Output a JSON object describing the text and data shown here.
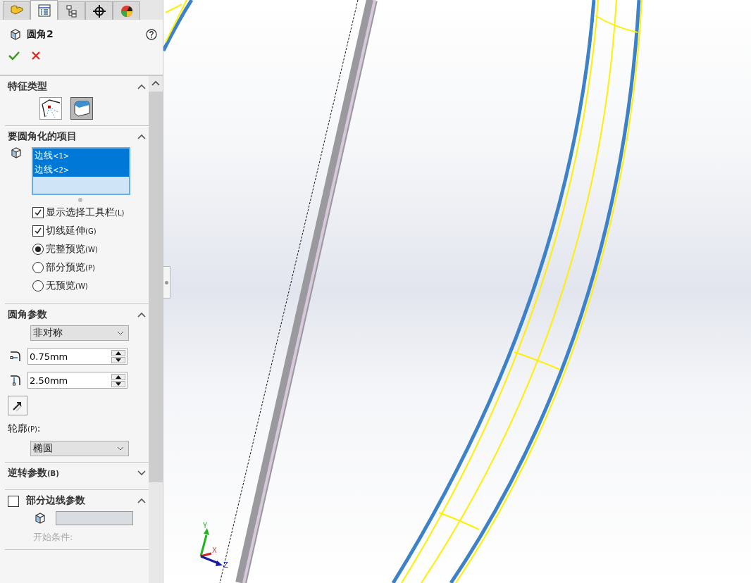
{
  "tabs": [
    {
      "kind": "part",
      "selected": false
    },
    {
      "kind": "properties",
      "selected": true
    },
    {
      "kind": "configuration",
      "selected": false
    },
    {
      "kind": "crosshair",
      "selected": false
    },
    {
      "kind": "appearance",
      "selected": false
    }
  ],
  "feature": {
    "title": "圆角2"
  },
  "sections": [
    {
      "kind": "feature_type",
      "title": "特征类型",
      "expanded": true,
      "options": [
        {
          "kind": "constant",
          "selected": false
        },
        {
          "kind": "variable",
          "selected": true
        }
      ]
    },
    {
      "kind": "items",
      "title": "要圆角化的项目",
      "expanded": true,
      "edges": [
        {
          "name": "边线",
          "index": "<1>",
          "selected": true
        },
        {
          "name": "边线",
          "index": "<2>",
          "selected": true
        }
      ],
      "checkboxes": [
        {
          "label": "显示选择工具栏",
          "shortcut": "(L)",
          "checked": true
        },
        {
          "label": "切线延伸",
          "shortcut": "(G)",
          "checked": true
        }
      ],
      "radios": [
        {
          "label": "完整预览",
          "shortcut": "(W)",
          "selected": true
        },
        {
          "label": "部分预览",
          "shortcut": "(P)",
          "selected": false
        },
        {
          "label": "无预览",
          "shortcut": "(W)",
          "selected": false
        }
      ]
    },
    {
      "kind": "params",
      "title": "圆角参数",
      "expanded": true,
      "method": "非对称",
      "distances": [
        {
          "kind": "distance1",
          "value": "0.75mm"
        },
        {
          "kind": "distance2",
          "value": "2.50mm"
        }
      ],
      "profile_label": "轮廓",
      "profile_shortcut": "(P)",
      "profile_colon": ":",
      "profile": "椭圆"
    },
    {
      "kind": "plain",
      "title": "逆转参数",
      "shortcut": "(B)",
      "expanded": false
    },
    {
      "kind": "partial",
      "title": "部分边线参数",
      "checked": false,
      "expanded": true,
      "start_condition": {
        "label": "开始条件:",
        "disabled": true
      }
    }
  ],
  "triad": {
    "x": "X",
    "y": "Y",
    "z": "Z"
  }
}
